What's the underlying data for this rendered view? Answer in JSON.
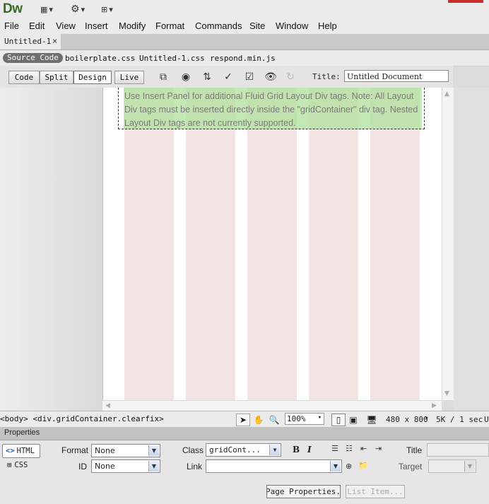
{
  "app": {
    "logo": "Dw"
  },
  "menu": [
    "File",
    "Edit",
    "View",
    "Insert",
    "Modify",
    "Format",
    "Commands",
    "Site",
    "Window",
    "Help"
  ],
  "document_tab": {
    "name": "Untitled-1",
    "close": "×"
  },
  "related_files": {
    "source_code": "Source Code",
    "files": [
      "boilerplate.css",
      "Untitled-1.css",
      "respond.min.js"
    ]
  },
  "view_buttons": [
    "Code",
    "Split",
    "Design",
    "Live"
  ],
  "active_view": "Design",
  "title_field": {
    "label": "Title:",
    "value": "Untitled Document"
  },
  "canvas": {
    "note": "Use Insert Panel for additional Fluid Grid Layout Div tags. Note: All Layout Div tags must be inserted directly inside the \"gridContainer\" div tag. Nested Layout Div tags are not currently supported.",
    "column_color": "#f3e4e4",
    "note_color": "#b2e2a0"
  },
  "status": {
    "tag_selector": "<body> <div.gridContainer.clearfix>",
    "zoom": "100%",
    "window_size": "480 x 800",
    "download": "5K / 1 sec",
    "encoding": "U"
  },
  "properties": {
    "header": "Properties",
    "html_label": "HTML",
    "css_label": "CSS",
    "format_label": "Format",
    "format_value": "None",
    "id_label": "ID",
    "id_value": "None",
    "class_label": "Class",
    "class_value": "gridCont...",
    "link_label": "Link",
    "link_value": "",
    "bold": "B",
    "italic": "I",
    "title_label": "Title",
    "title_value": "",
    "target_label": "Target",
    "target_value": "",
    "page_properties": "Page Properties...",
    "list_item": "List Item..."
  }
}
